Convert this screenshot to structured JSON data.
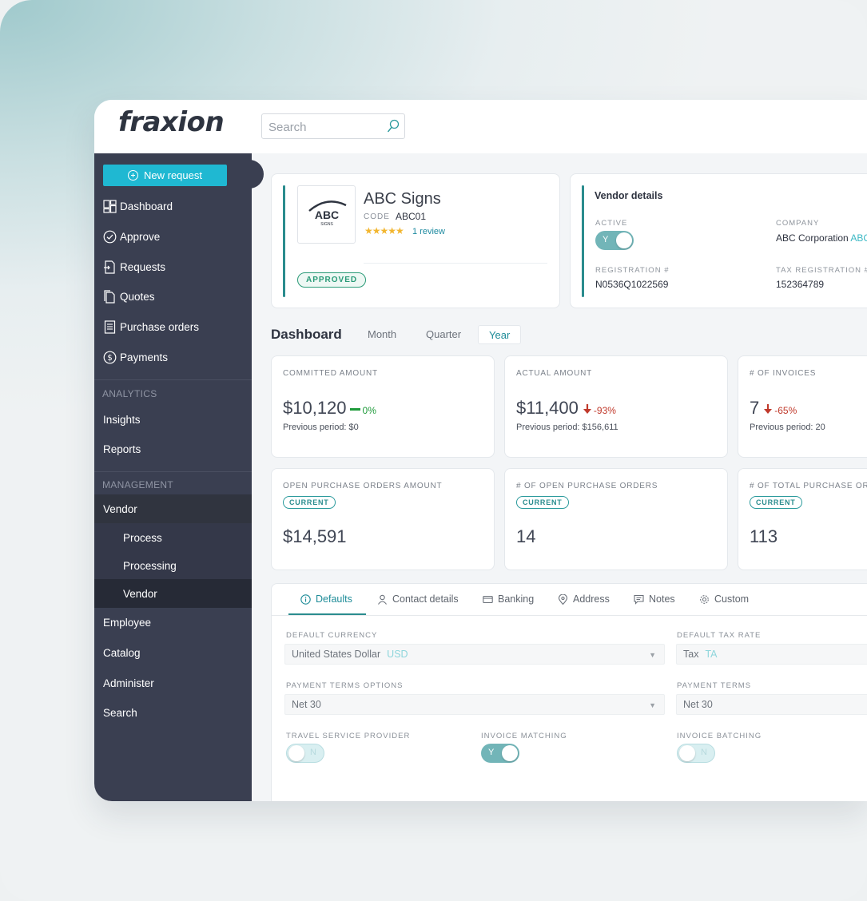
{
  "brand": {
    "logo_text": "fraxion"
  },
  "search": {
    "placeholder": "Search"
  },
  "sidebar": {
    "new_request": "New request",
    "main_items": [
      {
        "label": "Dashboard",
        "icon": "dashboard-icon"
      },
      {
        "label": "Approve",
        "icon": "check-circle-icon"
      },
      {
        "label": "Requests",
        "icon": "request-doc-icon"
      },
      {
        "label": "Quotes",
        "icon": "quotes-doc-icon"
      },
      {
        "label": "Purchase orders",
        "icon": "purchase-order-icon"
      },
      {
        "label": "Payments",
        "icon": "dollar-circle-icon"
      }
    ],
    "analytics_label": "ANALYTICS",
    "analytics_items": [
      "Insights",
      "Reports"
    ],
    "management_label": "MANAGEMENT",
    "vendor_group": "Vendor",
    "vendor_sub": [
      "Process",
      "Processing",
      "Vendor"
    ],
    "bottom_items": [
      "Employee",
      "Catalog",
      "Administer",
      "Search"
    ]
  },
  "vendor": {
    "logo_text": "ABC",
    "logo_sub": "SIGNS",
    "name": "ABC Signs",
    "code_label": "CODE",
    "code": "ABC01",
    "rating_stars": "★★★★★",
    "rating": 5,
    "review_text": "1 review",
    "status": "APPROVED"
  },
  "vendor_details": {
    "title": "Vendor details",
    "active_label": "ACTIVE",
    "active_value": "Y",
    "company_label": "COMPANY",
    "company": "ABC Corporation",
    "company_tag": "ABC",
    "registration_label": "REGISTRATION #",
    "registration": "N0536Q1022569",
    "tax_label": "TAX REGISTRATION #",
    "tax": "152364789"
  },
  "dashboard": {
    "title": "Dashboard",
    "ranges": [
      "Month",
      "Quarter",
      "Year"
    ],
    "selected_range": "Year",
    "kpis": [
      {
        "label": "COMMITTED AMOUNT",
        "value": "$10,120",
        "delta": "0%",
        "trend": "flat",
        "previous": "Previous period: $0"
      },
      {
        "label": "ACTUAL AMOUNT",
        "value": "$11,400",
        "delta": "-93%",
        "trend": "down",
        "previous": "Previous period: $156,611"
      },
      {
        "label": "# OF INVOICES",
        "value": "7",
        "delta": "-65%",
        "trend": "down",
        "previous": "Previous period: 20"
      }
    ],
    "po_kpis": [
      {
        "label": "OPEN PURCHASE ORDERS AMOUNT",
        "badge": "CURRENT",
        "value": "$14,591"
      },
      {
        "label": "# OF OPEN PURCHASE ORDERS",
        "badge": "CURRENT",
        "value": "14"
      },
      {
        "label": "# OF TOTAL PURCHASE ORDERS",
        "badge": "CURRENT",
        "value": "113"
      }
    ]
  },
  "detail_tabs": [
    {
      "label": "Defaults",
      "icon": "info-icon"
    },
    {
      "label": "Contact details",
      "icon": "person-icon"
    },
    {
      "label": "Banking",
      "icon": "card-icon"
    },
    {
      "label": "Address",
      "icon": "location-pin-icon"
    },
    {
      "label": "Notes",
      "icon": "note-bubble-icon"
    },
    {
      "label": "Custom",
      "icon": "gear-icon"
    }
  ],
  "defaults": {
    "currency_label": "DEFAULT CURRENCY",
    "currency": "United States Dollar",
    "currency_code": "USD",
    "tax_rate_label": "DEFAULT TAX RATE",
    "tax_rate": "Tax",
    "tax_rate_code": "TA",
    "payment_options_label": "PAYMENT TERMS OPTIONS",
    "payment_options": "Net 30",
    "payment_terms_label": "PAYMENT TERMS",
    "payment_terms": "Net 30",
    "travel_label": "TRAVEL SERVICE PROVIDER",
    "travel_value": "N",
    "invoice_matching_label": "INVOICE MATCHING",
    "invoice_matching_value": "Y",
    "invoice_batching_label": "INVOICE BATCHING",
    "invoice_batching_value": "N"
  },
  "colors": {
    "accent": "#2a8c8e",
    "sidebar": "#3a3f51",
    "primary_button": "#1fb8d2",
    "positive": "#1e9a3a",
    "negative": "#c0392b"
  }
}
